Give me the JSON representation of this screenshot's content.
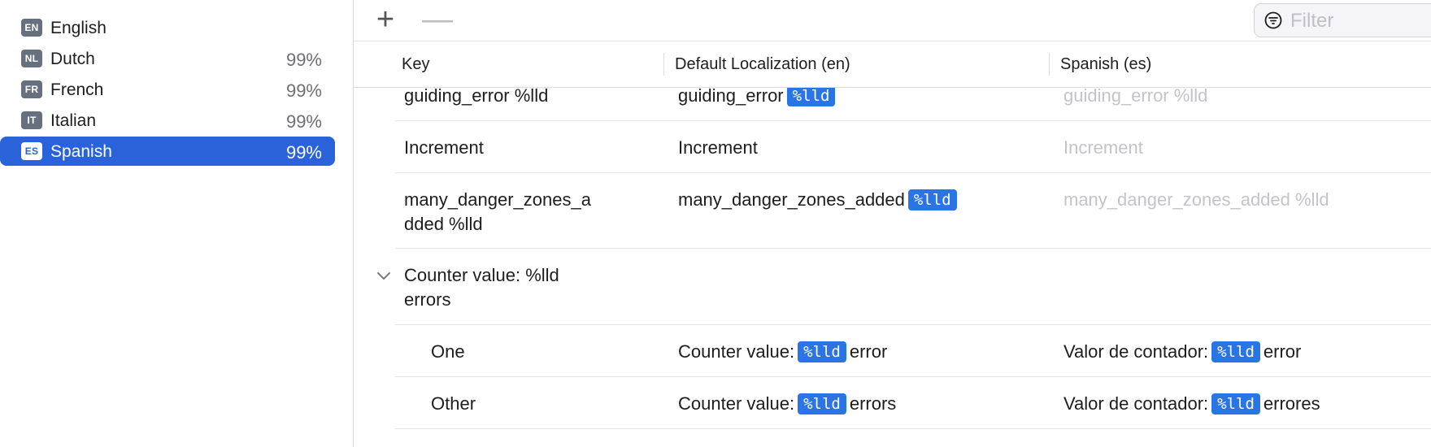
{
  "sidebar": {
    "languages": [
      {
        "code": "EN",
        "name": "English",
        "percent": ""
      },
      {
        "code": "NL",
        "name": "Dutch",
        "percent": "99%"
      },
      {
        "code": "FR",
        "name": "French",
        "percent": "99%"
      },
      {
        "code": "IT",
        "name": "Italian",
        "percent": "99%"
      },
      {
        "code": "ES",
        "name": "Spanish",
        "percent": "99%",
        "selected": true
      }
    ]
  },
  "toolbar": {
    "add_label": "+",
    "remove_label": "—",
    "filter_placeholder": "Filter"
  },
  "table": {
    "columns": [
      "Key",
      "Default Localization (en)",
      "Spanish (es)"
    ],
    "rows": [
      {
        "key": "guiding_error %lld",
        "default_pre": "guiding_error",
        "default_token": "%lld",
        "default_post": "",
        "translation": "guiding_error %lld"
      },
      {
        "key": "Increment",
        "default_pre": "Increment",
        "translation": "Increment"
      },
      {
        "key_line1": "many_danger_zones_a",
        "key_line2": "dded %lld",
        "default_pre": "many_danger_zones_added",
        "default_token": "%lld",
        "translation": "many_danger_zones_added %lld"
      },
      {
        "group_key_line1": "Counter value: %lld",
        "group_key_line2": "errors"
      },
      {
        "key": "One",
        "default_pre": "Counter value:",
        "default_token": "%lld",
        "default_post": "error",
        "translation_pre": "Valor de contador:",
        "translation_token": "%lld",
        "translation_post": "error"
      },
      {
        "key": "Other",
        "default_pre": "Counter value:",
        "default_token": "%lld",
        "default_post": "errors",
        "translation_pre": "Valor de contador:",
        "translation_token": "%lld",
        "translation_post": "errores"
      }
    ]
  },
  "colors": {
    "selection": "#2962d9",
    "token": "#2b74e6",
    "placeholder_text": "#c4c4c8"
  }
}
